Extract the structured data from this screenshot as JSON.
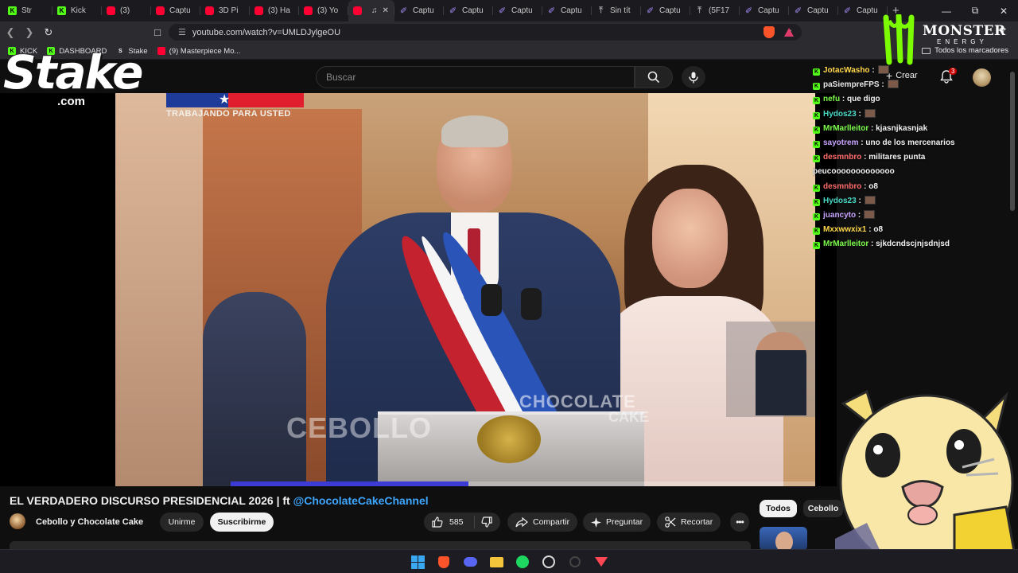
{
  "browser": {
    "tabs": [
      {
        "label": "Str",
        "icon": "kick-icon",
        "active": false
      },
      {
        "label": "Kick",
        "icon": "kick-icon",
        "active": false
      },
      {
        "label": "(3)",
        "icon": "youtube-icon",
        "active": false
      },
      {
        "label": "Captu",
        "icon": "youtube-icon",
        "active": false
      },
      {
        "label": "3D Pi",
        "icon": "youtube-icon",
        "active": false
      },
      {
        "label": "(3) Ha",
        "icon": "youtube-icon",
        "active": false
      },
      {
        "label": "(3) Yo",
        "icon": "youtube-icon",
        "active": false
      },
      {
        "label": "",
        "icon": "youtube-icon",
        "active": true
      },
      {
        "label": "Captu",
        "icon": "pen-icon",
        "active": false
      },
      {
        "label": "Captu",
        "icon": "pen-icon",
        "active": false
      },
      {
        "label": "Captu",
        "icon": "pen-icon",
        "active": false
      },
      {
        "label": "Captu",
        "icon": "pen-icon",
        "active": false
      },
      {
        "label": "Sin tít",
        "icon": "upload-icon",
        "active": false
      },
      {
        "label": "Captu",
        "icon": "pen-icon",
        "active": false
      },
      {
        "label": "(5F17",
        "icon": "upload-icon",
        "active": false
      },
      {
        "label": "Captu",
        "icon": "pen-icon",
        "active": false
      },
      {
        "label": "Captu",
        "icon": "pen-icon",
        "active": false
      },
      {
        "label": "Captu",
        "icon": "pen-icon",
        "active": false
      }
    ],
    "url": "youtube.com/watch?v=UMLDJylgeOU",
    "bookmarks": [
      {
        "label": "KICK",
        "icon": "kick-icon"
      },
      {
        "label": "DASHBOARD",
        "icon": "kick-icon"
      },
      {
        "label": "Stake",
        "icon": "stake-icon"
      },
      {
        "label": "(9) Masterpiece Mo...",
        "icon": "youtube-icon"
      }
    ],
    "all_bookmarks_label": "Todos los marcadores"
  },
  "youtube": {
    "search_placeholder": "Buscar",
    "create_label": "Crear",
    "notification_count": "3"
  },
  "video": {
    "overlay_caption": "TRABAJANDO PARA USTED",
    "watermark_chocolate": "CHOCOLATE",
    "watermark_cake": "CAKE",
    "watermark_cebollo": "CEBOLLO",
    "progress_fraction": 0.34,
    "title_text": "EL VERDADERO DISCURSO PRESIDENCIAL 2026 | ft ",
    "title_link": "@ChocolateCakeChannel",
    "channel_name": "Cebollo y Chocolate Cake",
    "join_label": "Unirme",
    "subscribe_label": "Suscribirme",
    "like_count": "585",
    "share_label": "Compartir",
    "ask_label": "Preguntar",
    "clip_label": "Recortar"
  },
  "sidebar": {
    "chips": [
      "Todos",
      "Cebollo"
    ]
  },
  "stream_overlay": {
    "stake_word": "Stake",
    "stake_com": ".com",
    "monster_word": "MONSTER",
    "monster_sub": "ENERGY",
    "chat": [
      {
        "user": "JotacWasho",
        "color": "#ffd84a",
        "msg": ":",
        "emote": true
      },
      {
        "user": "paSiempreFPS",
        "color": "#e6e6e6",
        "msg": ":",
        "emote": true
      },
      {
        "user": "nefu",
        "color": "#7cfc4a",
        "msg": ": que digo",
        "emote": false
      },
      {
        "user": "Hydos23",
        "color": "#4ad9c6",
        "msg": ":",
        "emote": true
      },
      {
        "user": "MrMarlleitor",
        "color": "#7cfc4a",
        "msg": ": kjasnjkasnjak",
        "emote": false
      },
      {
        "user": "sayotrem",
        "color": "#c7a3ff",
        "msg": ": uno de los mercenarios",
        "emote": false
      },
      {
        "user": "desmnbro",
        "color": "#ff6b6b",
        "msg": ": militares punta peucooooooooooooo",
        "emote": false
      },
      {
        "user": "desmnbro",
        "color": "#ff6b6b",
        "msg": ": o8",
        "emote": false
      },
      {
        "user": "Hydos23",
        "color": "#4ad9c6",
        "msg": ":",
        "emote": true
      },
      {
        "user": "juancyto",
        "color": "#c7a3ff",
        "msg": ":",
        "emote": true
      },
      {
        "user": "Mxxwwxix1",
        "color": "#ffd84a",
        "msg": ": o8",
        "emote": false
      },
      {
        "user": "MrMarlleitor",
        "color": "#7cfc4a",
        "msg": ": sjkdcndscjnjsdnjsd",
        "emote": false
      }
    ]
  }
}
